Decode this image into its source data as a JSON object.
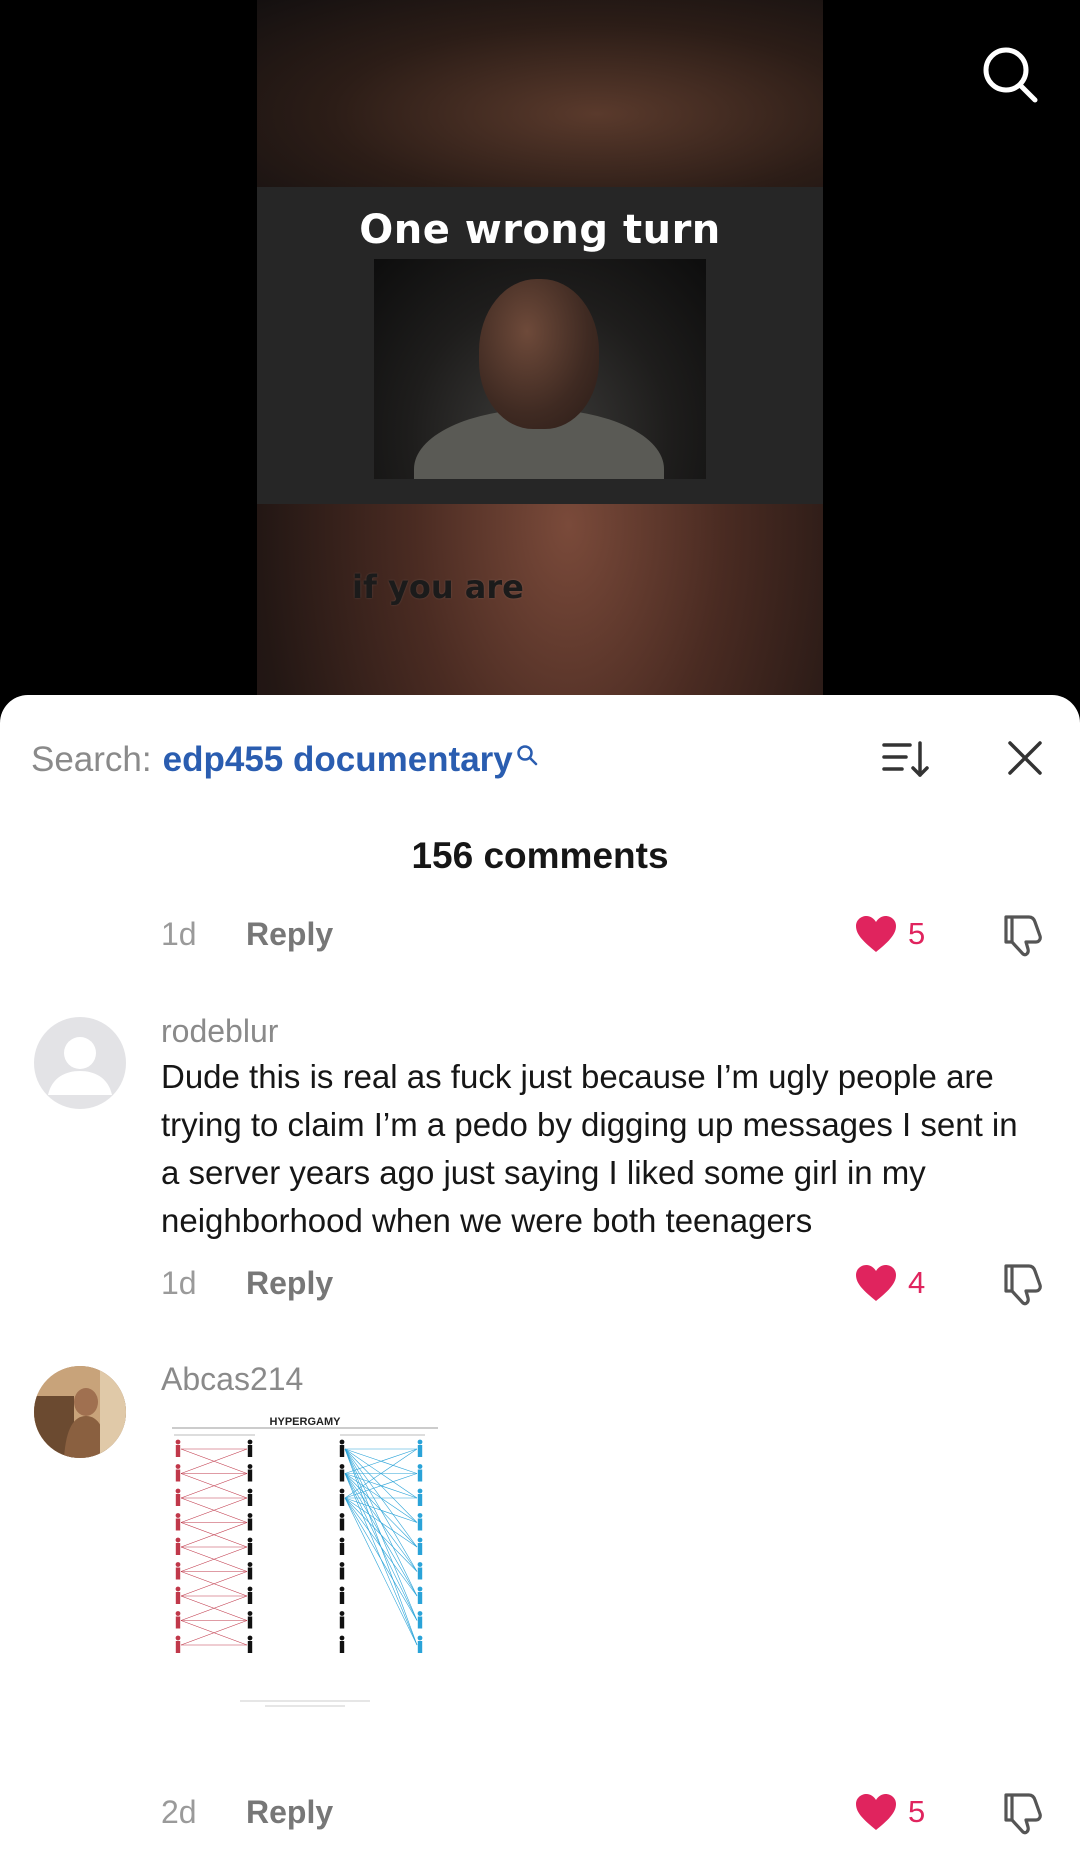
{
  "video": {
    "overlay_title": "One wrong turn",
    "overlay_subtext": "if you are",
    "search_icon": "search-icon"
  },
  "comments_panel": {
    "search_prefix": "Search:",
    "search_query": "edp455 documentary",
    "count_label": "156 comments",
    "icons": {
      "sort": "sort-icon",
      "close": "close-icon",
      "heart": "heart-icon",
      "dislike": "dislike-icon"
    },
    "accent_like_color": "#e0245e",
    "search_query_color": "#2a5db0",
    "reply_label": "Reply",
    "comments": [
      {
        "time": "1d",
        "likes": "5"
      },
      {
        "username": "rodeblur",
        "text": "Dude this is real as fuck just because I’m ugly people are trying to claim I’m a pedo by digging up messages I sent in a server years ago just saying I liked some girl in my neighborhood when we were both teenagers",
        "time": "1d",
        "likes": "4"
      },
      {
        "username": "Abcas214",
        "image_title": "HYPERGAMY",
        "time": "2d",
        "likes": "5"
      }
    ]
  }
}
